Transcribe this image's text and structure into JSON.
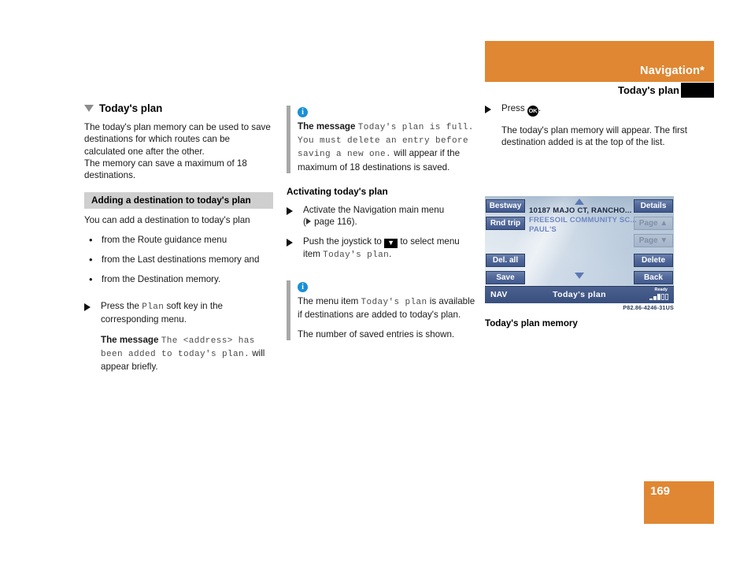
{
  "header": {
    "title": "Navigation*",
    "subtitle": "Today's plan"
  },
  "page_number": "169",
  "column1": {
    "heading": "Today's plan",
    "intro_p1": "The today's plan memory can be used to save destinations for which routes can be calculated one after the other.",
    "intro_p2": "The memory can save a maximum of 18 destinations.",
    "gray_heading": "Adding a destination to today's plan",
    "lead": "You can add a destination to today's plan",
    "bullets": [
      "from the Route guidance menu",
      "from the Last destinations memory and",
      "from the Destination memory."
    ],
    "action_press_plan_pre": "Press the ",
    "action_press_plan_mono": "Plan",
    "action_press_plan_post": " soft key in the corresponding menu.",
    "message_pre": "The message ",
    "message_mono": "The <address> has been added to today's plan.",
    "message_post": " will appear briefly."
  },
  "column2": {
    "note1_pre": "The message ",
    "note1_mono": "Today's plan is full. You must delete an entry before saving a new one.",
    "note1_post": " will appear if the maximum of 18 destinations is saved.",
    "sub_heading": "Activating today's plan",
    "action1": "Activate the Navigation main menu (▷ page 116).",
    "action1_text": "Activate the Navigation main menu",
    "action1_ref": " page 116).",
    "action2_pre": "Push the joystick to ",
    "action2_key": "▼",
    "action2_mid": " to select menu item ",
    "action2_mono": "Today's plan",
    "action2_post": ".",
    "note2_pre": "The menu item ",
    "note2_mono": "Today's plan",
    "note2_post": " is available if destinations are added to today's plan.",
    "note2_line2": "The number of saved entries is shown."
  },
  "column3": {
    "action_press_pre": "Press ",
    "action_press_key": "OK",
    "action_press_post": ".",
    "action_desc": "The today's plan memory will appear. The first destination added is at the top of the list.",
    "shot_code": "P82.86-4246-31US",
    "shot_caption": "Today's plan memory"
  },
  "nav_screen": {
    "soft_keys_left": [
      {
        "label": "Bestway",
        "disabled": false
      },
      {
        "label": "Rnd trip",
        "disabled": false
      },
      {
        "label": "Del. all",
        "disabled": false
      },
      {
        "label": "Save",
        "disabled": false
      }
    ],
    "soft_keys_right": [
      {
        "label": "Details",
        "disabled": false
      },
      {
        "label": "Page ▲",
        "disabled": true
      },
      {
        "label": "Page ▼",
        "disabled": true
      },
      {
        "label": "Delete",
        "disabled": false
      },
      {
        "label": "Back",
        "disabled": false
      }
    ],
    "list": [
      {
        "text": "10187 MAJO CT, RANCHO...",
        "selected": true
      },
      {
        "text": "FREESOIL COMMUNITY SC...",
        "selected": false
      },
      {
        "text": "PAUL'S",
        "selected": false
      }
    ],
    "status": {
      "mode": "NAV",
      "title": "Today's plan",
      "signal_label": "Ready"
    }
  },
  "colors": {
    "accent_orange": "#e08733",
    "info_blue": "#1a8fd8",
    "gray_heading_bg": "#cfcfcf",
    "nav_key_blue": "#53699a",
    "nav_status_blue": "#3f5785"
  }
}
